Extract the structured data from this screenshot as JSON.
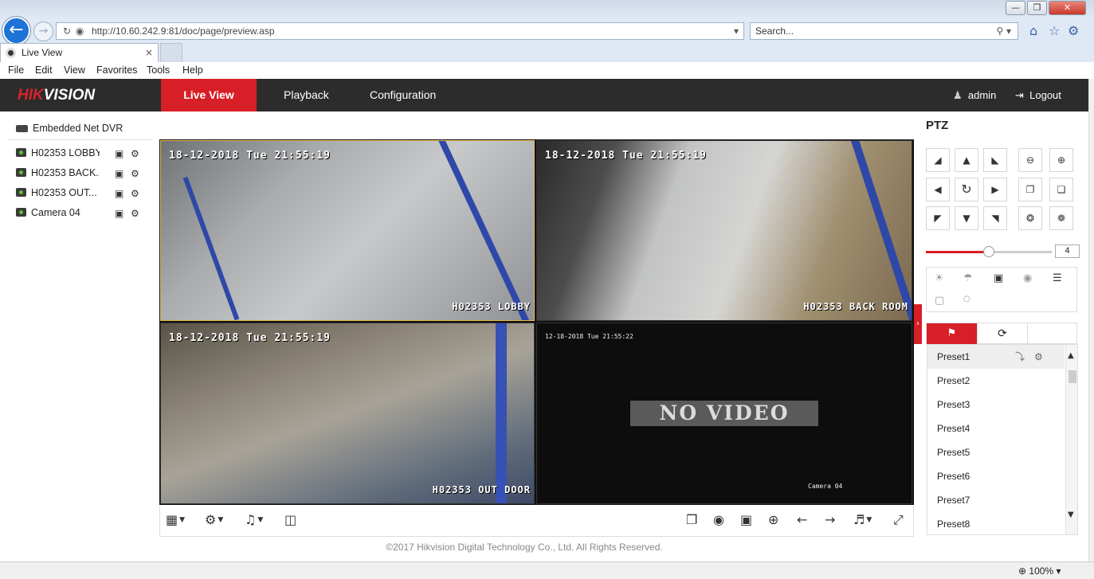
{
  "browser": {
    "window_controls": [
      "—",
      "❐",
      "✕"
    ],
    "url": "http://10.60.242.9:81/doc/page/preview.asp",
    "search_placeholder": "Search...",
    "tab_title": "Live View",
    "menu": [
      "File",
      "Edit",
      "View",
      "Favorites",
      "Tools",
      "Help"
    ],
    "zoom": "100%"
  },
  "app": {
    "brand": {
      "part1": "HIK",
      "part2": "VISION"
    },
    "nav": [
      "Live View",
      "Playback",
      "Configuration"
    ],
    "active_nav": "Live View",
    "user": "admin",
    "logout": "Logout",
    "accent_color": "#d71f27",
    "header_color": "#2c2c2c"
  },
  "tree": {
    "device": "Embedded Net DVR",
    "cameras": [
      {
        "label": "H02353 LOBBY"
      },
      {
        "label": "H02353 BACK..."
      },
      {
        "label": "H02353 OUT..."
      },
      {
        "label": "Camera 04"
      }
    ]
  },
  "video": {
    "tiles": [
      {
        "timestamp": "18-12-2018 Tue 21:55:19",
        "camera_name": "H02353 LOBBY"
      },
      {
        "timestamp": "18-12-2018 Tue 21:55:19",
        "camera_name": "H02353 BACK ROOM"
      },
      {
        "timestamp": "18-12-2018 Tue 21:55:19",
        "camera_name": "H02353 OUT DOOR"
      },
      {
        "timestamp": "12-18-2018 Tue 21:55:22",
        "camera_name": "Camera 04",
        "no_video_text": "NO VIDEO"
      }
    ]
  },
  "ptz": {
    "title": "PTZ",
    "speed": "4",
    "speed_fraction": 0.5,
    "presets": [
      "Preset1",
      "Preset2",
      "Preset3",
      "Preset4",
      "Preset5",
      "Preset6",
      "Preset7",
      "Preset8"
    ],
    "selected_preset": "Preset1"
  },
  "footer": {
    "copyright": "©2017 Hikvision Digital Technology Co., Ltd. All Rights Reserved."
  }
}
